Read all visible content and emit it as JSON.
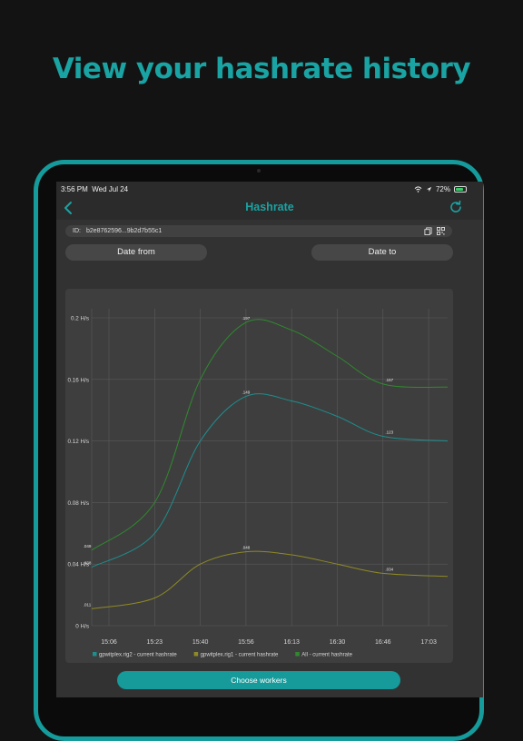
{
  "headline": "View your hashrate history",
  "status_bar": {
    "time": "3:56 PM",
    "date": "Wed Jul 24",
    "battery": "72%",
    "battery_level": 0.72
  },
  "navbar": {
    "title": "Hashrate"
  },
  "id_bar": {
    "label": "ID:",
    "value": "b2e8762596...9b2d7b55c1"
  },
  "date_from_label": "Date from",
  "date_to_label": "Date to",
  "choose_workers_label": "Choose workers",
  "colors": {
    "accent": "#1aa3a3",
    "rig2": "#1e8e8e",
    "rig1": "#8f8a25",
    "all": "#2f8a2f"
  },
  "chart_data": {
    "type": "line",
    "x": [
      "15:06",
      "15:23",
      "15:40",
      "15:56",
      "16:13",
      "16:30",
      "16:46",
      "17:03"
    ],
    "yticks": [
      "0 H/s",
      "0.04 H/s",
      "0.08 H/s",
      "0.12 H/s",
      "0.16 H/s",
      "0.2 H/s"
    ],
    "ylim": [
      0,
      0.2
    ],
    "series": [
      {
        "name": "gpwitplex.rig2 - current hashrate",
        "color": "#1e8e8e",
        "values": [
          0.038,
          0.06,
          0.12,
          0.149,
          0.146,
          0.136,
          0.123,
          0.12
        ]
      },
      {
        "name": "gpwitplex.rig1 - current hashrate",
        "color": "#8f8a25",
        "values": [
          0.011,
          0.018,
          0.04,
          0.048,
          0.046,
          0.04,
          0.034,
          0.032
        ]
      },
      {
        "name": "All - current hashrate",
        "color": "#2f8a2f",
        "values": [
          0.049,
          0.08,
          0.16,
          0.197,
          0.192,
          0.175,
          0.157,
          0.155
        ]
      }
    ],
    "annotations": [
      {
        "x_index": 0,
        "text": ".049",
        "value": 0.049
      },
      {
        "x_index": 0,
        "text": ".038",
        "value": 0.038
      },
      {
        "x_index": 0,
        "text": ".011",
        "value": 0.011
      },
      {
        "x_index": 3,
        "text": ".197",
        "value": 0.197
      },
      {
        "x_index": 3,
        "text": ".149",
        "value": 0.149
      },
      {
        "x_index": 3,
        "text": ".048",
        "value": 0.048
      },
      {
        "x_index": 6,
        "text": ".157",
        "value": 0.157
      },
      {
        "x_index": 6,
        "text": ".123",
        "value": 0.123
      },
      {
        "x_index": 6,
        "text": ".034",
        "value": 0.034
      }
    ],
    "grid": true,
    "legend": "bottom"
  }
}
